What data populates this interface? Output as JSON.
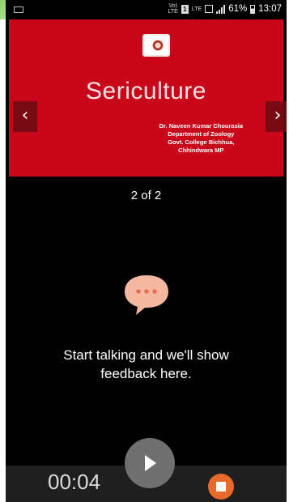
{
  "status_bar": {
    "volte": "Vo)\nLTE",
    "sim": "1",
    "lte": "LTE",
    "battery": "61%",
    "time": "13:07"
  },
  "slide": {
    "title": "Sericulture",
    "author_lines": [
      "Dr. Naveen Kumar Chourasia",
      "Department of Zoology",
      "Govt. College Bichhua,",
      "Chhindwara MP"
    ],
    "prev_glyph": "‹",
    "next_glyph": "›"
  },
  "counter": "2 of 2",
  "feedback": {
    "line1": "Start talking and we'll show",
    "line2": "feedback here."
  },
  "controls": {
    "timer": "00:04",
    "play_icon": "play-icon",
    "stop_icon": "stop-icon",
    "stop_color": "#e8692a",
    "bubble_color": "#f4b8a0"
  }
}
